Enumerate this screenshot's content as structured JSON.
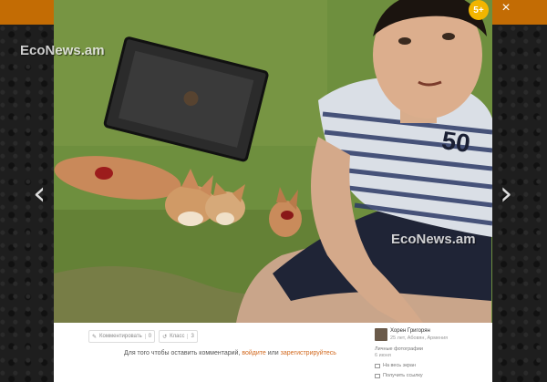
{
  "viewer": {
    "age_rating": "5+",
    "close_label": "×",
    "prev_label": "‹",
    "next_label": "›",
    "watermark_left": "EcoNews.am",
    "watermark_right": "EcoNews.am"
  },
  "photo": {
    "shirt_text": "50"
  },
  "actions": {
    "comment_label": "Комментировать",
    "comment_count": "0",
    "like_label": "Класс",
    "like_count": "3"
  },
  "comment_hint": {
    "prefix": "Для того чтобы оставить комментарий, ",
    "login_link": "войдите",
    "middle": " или ",
    "register_link": "зарегистрируйтесь"
  },
  "author": {
    "name": "Хорен Григорян",
    "meta": "25 лет, Абовян, Армения",
    "album": "Личные фотографии",
    "date": "6 июня",
    "fullscreen_label": "На весь экран",
    "getlink_label": "Получить ссылку"
  },
  "colors": {
    "topbar": "#e07a00",
    "age_badge": "#f2b500",
    "link": "#d2691e"
  }
}
